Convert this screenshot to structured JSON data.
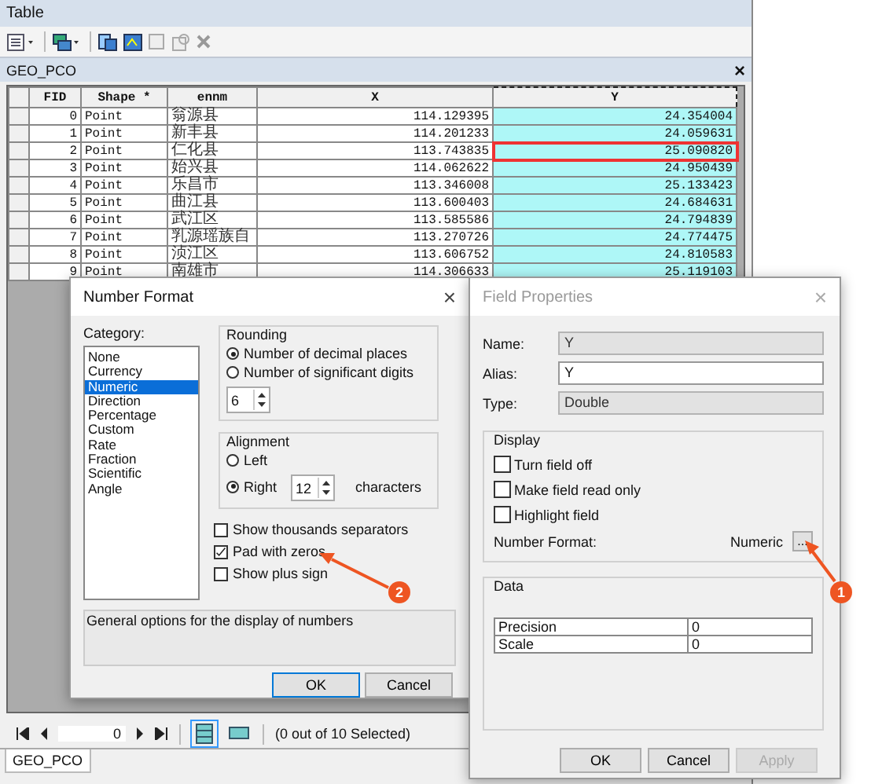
{
  "table_window": {
    "title": "Table",
    "tab": "GEO_PCO",
    "close": "×",
    "columns": [
      {
        "label": "FID",
        "selected": false
      },
      {
        "label": "Shape *",
        "selected": false
      },
      {
        "label": "ennm",
        "selected": false
      },
      {
        "label": "X",
        "selected": false
      },
      {
        "label": "Y",
        "selected": true
      }
    ],
    "rows": [
      [
        "0",
        "Point",
        "翁源县",
        "114.129395",
        "24.354004"
      ],
      [
        "1",
        "Point",
        "新丰县",
        "114.201233",
        "24.059631"
      ],
      [
        "2",
        "Point",
        "仁化县",
        "113.743835",
        "25.090820"
      ],
      [
        "3",
        "Point",
        "始兴县",
        "114.062622",
        "24.950439"
      ],
      [
        "4",
        "Point",
        "乐昌市",
        "113.346008",
        "25.133423"
      ],
      [
        "5",
        "Point",
        "曲江县",
        "113.600403",
        "24.684631"
      ],
      [
        "6",
        "Point",
        "武江区",
        "113.585586",
        "24.794839"
      ],
      [
        "7",
        "Point",
        "乳源瑶族自",
        "113.270726",
        "24.774475"
      ],
      [
        "8",
        "Point",
        "浈江区",
        "113.606752",
        "24.810583"
      ],
      [
        "9",
        "Point",
        "南雄市",
        "114.306633",
        "25.119103"
      ]
    ],
    "highlighted_rows": [
      false,
      false,
      true,
      false,
      false,
      false,
      false,
      false,
      false,
      false
    ],
    "record": "0",
    "selection_status": "(0 out of 10 Selected)",
    "bottom_tab": "GEO_PCO"
  },
  "number_format": {
    "title": "Number Format",
    "close": "×",
    "category_label": "Category:",
    "categories": [
      {
        "label": "None",
        "selected": false
      },
      {
        "label": "Currency",
        "selected": false
      },
      {
        "label": "Numeric",
        "selected": true
      },
      {
        "label": "Direction",
        "selected": false
      },
      {
        "label": "Percentage",
        "selected": false
      },
      {
        "label": "Custom",
        "selected": false
      },
      {
        "label": "Rate",
        "selected": false
      },
      {
        "label": "Fraction",
        "selected": false
      },
      {
        "label": "Scientific",
        "selected": false
      },
      {
        "label": "Angle",
        "selected": false
      }
    ],
    "rounding": {
      "title": "Rounding",
      "options": [
        {
          "label": "Number of decimal places",
          "selected": true
        },
        {
          "label": "Number of significant digits",
          "selected": false
        }
      ],
      "value": "6"
    },
    "alignment": {
      "title": "Alignment",
      "options": [
        {
          "label": "Left",
          "selected": false
        },
        {
          "label": "Right",
          "selected": true
        }
      ],
      "value": "12",
      "unit": "characters"
    },
    "checks": [
      {
        "label": "Show thousands separators",
        "checked": false
      },
      {
        "label": "Pad with zeros",
        "checked": true
      },
      {
        "label": "Show plus sign",
        "checked": false
      }
    ],
    "description": "General options for the display of numbers",
    "buttons": [
      "OK",
      "Cancel"
    ]
  },
  "field_properties": {
    "title": "Field Properties",
    "close": "×",
    "fields": [
      {
        "label": "Name:",
        "value": "Y",
        "readonly": true
      },
      {
        "label": "Alias:",
        "value": "Y",
        "readonly": false
      },
      {
        "label": "Type:",
        "value": "Double",
        "readonly": true
      }
    ],
    "display": {
      "title": "Display",
      "checks": [
        {
          "label": "Turn field off",
          "checked": false
        },
        {
          "label": "Make field read only",
          "checked": false
        },
        {
          "label": "Highlight field",
          "checked": false
        }
      ],
      "number_format_label": "Number Format:",
      "number_format_value": "Numeric",
      "more": "..."
    },
    "data": {
      "title": "Data",
      "rows": [
        [
          "Precision",
          "0"
        ],
        [
          "Scale",
          "0"
        ]
      ]
    },
    "buttons": [
      {
        "label": "OK",
        "disabled": false
      },
      {
        "label": "Cancel",
        "disabled": false
      },
      {
        "label": "Apply",
        "disabled": true
      }
    ]
  },
  "markers": [
    "2",
    "1"
  ]
}
